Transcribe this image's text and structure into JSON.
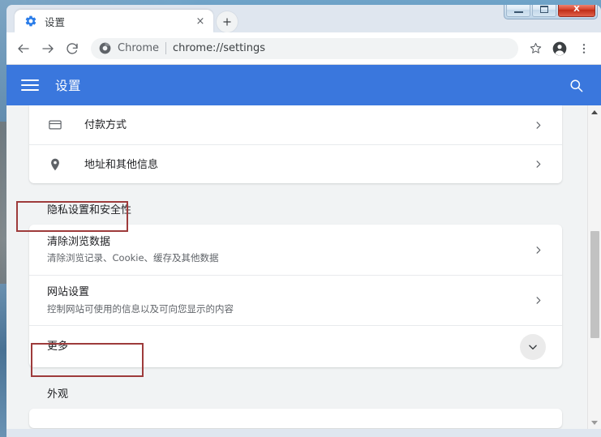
{
  "window": {
    "controls": {
      "minimize_label": "Minimize",
      "maximize_label": "Maximize",
      "close_label": "X"
    }
  },
  "tab": {
    "title": "设置",
    "favicon": "gear-icon",
    "close_glyph": "×",
    "new_tab_glyph": "+"
  },
  "toolbar": {
    "back_label": "←",
    "forward_label": "→",
    "reload_label": "⟳",
    "omnibox": {
      "scheme_label": "Chrome",
      "url": "chrome://settings",
      "security_icon": "chrome-logo-icon"
    },
    "bookmark_icon": "star-icon",
    "profile_icon": "account-circle-icon",
    "menu_icon": "three-dots-menu-icon"
  },
  "settings_header": {
    "menu_icon": "hamburger-icon",
    "title": "设置",
    "search_icon": "search-icon",
    "background_color": "#3a77dd"
  },
  "content": {
    "autofill_card": [
      {
        "icon": "credit-card-icon",
        "title": "付款方式",
        "sub": "",
        "arrow": "chevron-right-icon"
      },
      {
        "icon": "location-pin-icon",
        "title": "地址和其他信息",
        "sub": "",
        "arrow": "chevron-right-icon"
      }
    ],
    "privacy_section": {
      "header": "隐私设置和安全性",
      "rows": [
        {
          "title": "清除浏览数据",
          "sub": "清除浏览记录、Cookie、缓存及其他数据",
          "arrow": "chevron-right-icon"
        },
        {
          "title": "网站设置",
          "sub": "控制网站可使用的信息以及可向您显示的内容",
          "arrow": "chevron-right-icon"
        },
        {
          "title": "更多",
          "sub": "",
          "arrow": "chevron-down-circle-icon"
        }
      ]
    },
    "appearance_section": {
      "header": "外观"
    }
  },
  "annotations": {
    "color": "#9e3b3b",
    "boxes": [
      {
        "name": "privacy-header-highlight",
        "target": "隐私设置和安全性"
      },
      {
        "name": "more-row-highlight",
        "target": "更多"
      }
    ]
  },
  "scrollbar": {
    "up_arrow": "triangle-up-icon",
    "down_arrow": "triangle-down-icon",
    "thumb_position_percent": 40
  }
}
